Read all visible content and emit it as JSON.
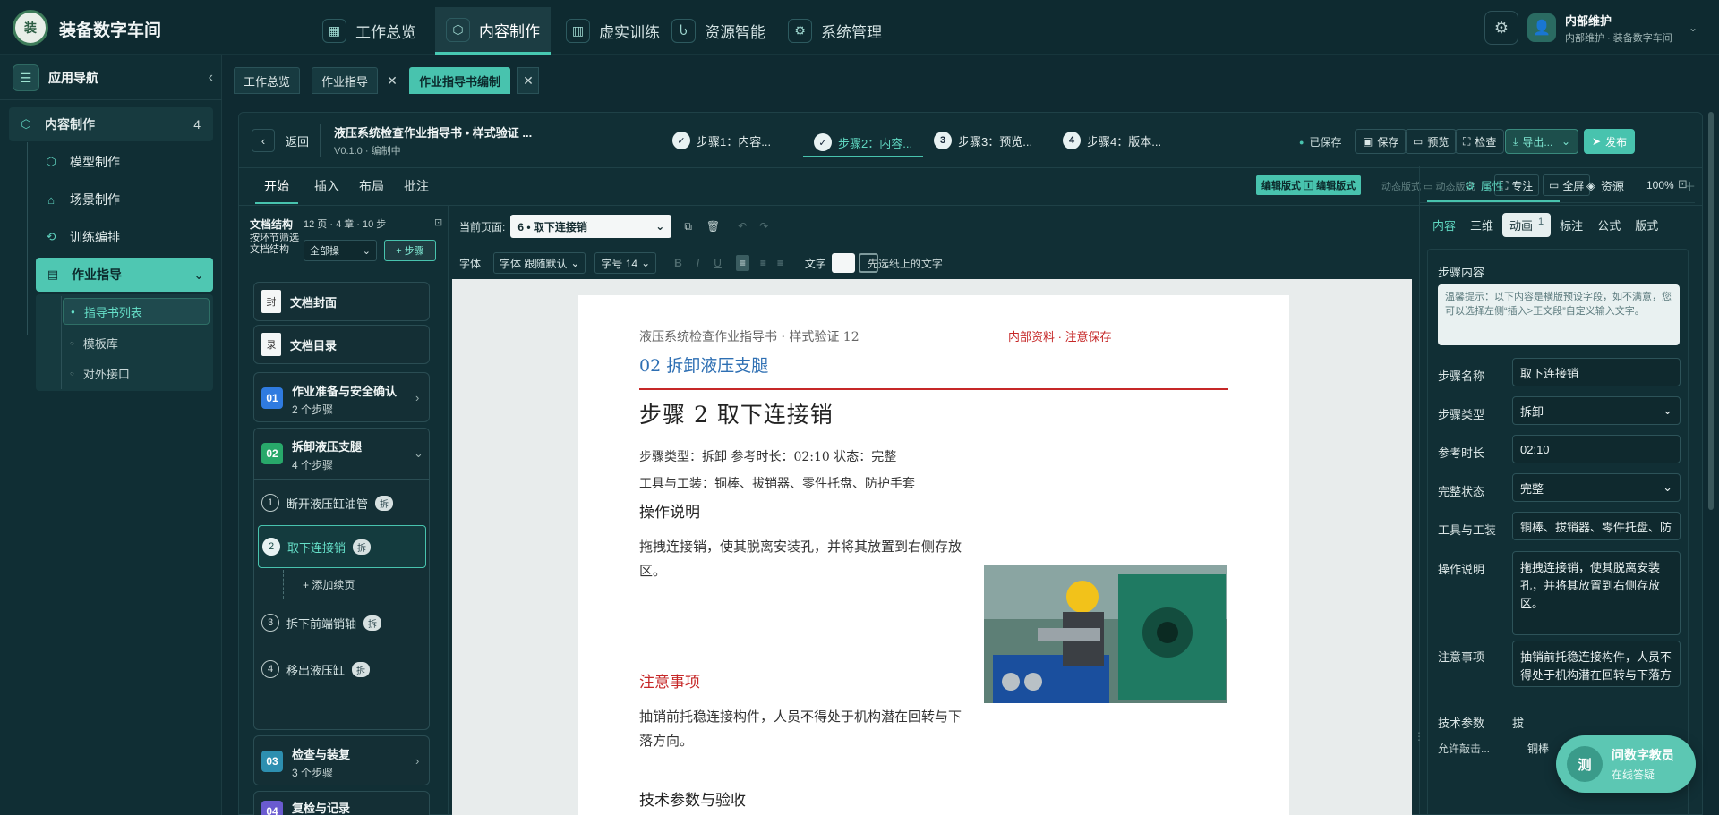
{
  "app": {
    "title": "装备数字车间",
    "logo_text": "装"
  },
  "topnav": [
    {
      "label": "工作总览",
      "icon": "grid-icon",
      "glyph": "▦"
    },
    {
      "label": "内容制作",
      "icon": "cube-icon",
      "glyph": "⬡"
    },
    {
      "label": "虚实训练",
      "icon": "book-icon",
      "glyph": "▥"
    },
    {
      "label": "资源智能",
      "icon": "hook-icon",
      "glyph": "Ⴑ"
    },
    {
      "label": "系统管理",
      "icon": "gear-icon",
      "glyph": "⚙"
    }
  ],
  "user": {
    "name": "内部维护",
    "subtitle": "内部维护 · 装备数字车间"
  },
  "sidebar": {
    "title": "应用导航",
    "section": {
      "label": "内容制作",
      "count": "4"
    },
    "items": [
      {
        "label": "模型制作"
      },
      {
        "label": "场景制作"
      },
      {
        "label": "训练编排"
      },
      {
        "label": "作业指导"
      }
    ],
    "subitems": [
      {
        "label": "指导书列表"
      },
      {
        "label": "模板库"
      },
      {
        "label": "对外接口"
      }
    ]
  },
  "worktabs": [
    {
      "label": "工作总览"
    },
    {
      "label": "作业指导"
    },
    {
      "label": "作业指导书编制"
    }
  ],
  "editor": {
    "back": "返回",
    "doc_title": "液压系统检查作业指导书 • 样式验证 ...",
    "doc_version": "V0.1.0 · 编制中",
    "steps": [
      {
        "num": "✓",
        "label": "步骤1：内容..."
      },
      {
        "num": "✓",
        "label": "步骤2：内容..."
      },
      {
        "num": "3",
        "label": "步骤3：预览..."
      },
      {
        "num": "4",
        "label": "步骤4：版本..."
      }
    ],
    "saved": "已保存",
    "buttons": {
      "save": "保存",
      "preview": "预览",
      "check": "检查",
      "export": "导出...",
      "publish": "发布"
    },
    "ribbon_tabs": [
      "开始",
      "插入",
      "布局",
      "批注"
    ],
    "mode_edit": "编辑版式 🄸 编辑版式",
    "mode_dynamic": "动态版式 ▭ 动态版式",
    "focus": "专注",
    "fullscreen": "全屏",
    "zoom": "100%"
  },
  "structure": {
    "title": "文档结构",
    "summary": "12 页 · 4 章 · 10 步",
    "label2": "按环节筛选文档结构",
    "filter": "全部操",
    "add": "+ 步骤",
    "cover": {
      "badge": "封",
      "label": "文档封面"
    },
    "toc": {
      "badge": "录",
      "label": "文档目录"
    },
    "chapters": [
      {
        "num": "01",
        "title": "作业准备与安全确认",
        "sub": "2 个步骤",
        "color": "#2f7be0"
      },
      {
        "num": "02",
        "title": "拆卸液压支腿",
        "sub": "4 个步骤",
        "color": "#28a86a"
      },
      {
        "num": "03",
        "title": "检查与装复",
        "sub": "3 个步骤",
        "color": "#2d8fb0"
      },
      {
        "num": "04",
        "title": "复检与记录",
        "sub": "",
        "color": "#6a5bd0"
      }
    ],
    "steps": [
      {
        "num": "1",
        "label": "断开液压缸油管",
        "tag": "拆"
      },
      {
        "num": "2",
        "label": "取下连接销",
        "tag": "拆"
      },
      {
        "num": "3",
        "label": "拆下前端销轴",
        "tag": "拆"
      },
      {
        "num": "4",
        "label": "移出液压缸",
        "tag": "拆"
      }
    ],
    "add_page": "+ 添加续页"
  },
  "pagebar": {
    "current_label": "当前页面:",
    "current_value": "6 • 取下连接销"
  },
  "fontbar": {
    "font_label": "字体",
    "font_value": "字体 跟随默认",
    "size_value": "字号 14",
    "text_label": "文字",
    "hint": "先选纸上的文字"
  },
  "page": {
    "header_left": "液压系统检查作业指导书 · 样式验证 12",
    "header_right": "内部资料 · 注意保存",
    "chapter": "02 拆卸液压支腿",
    "step_title": "步骤 2 取下连接销",
    "meta1": "步骤类型：拆卸 参考时长：02:10 状态：完整",
    "meta2": "工具与工装：铜棒、拔销器、零件托盘、防护手套",
    "h_ops": "操作说明",
    "ops": "拖拽连接销，使其脱离安装孔，并将其放置到右侧存放区。",
    "h_notes": "注意事项",
    "notes": "抽销前托稳连接构件，人员不得处于机构潜在回转与下落方向。",
    "h_params": "技术参数与验收"
  },
  "props": {
    "tab_props": "属性",
    "tab_assets": "资源",
    "subtabs": [
      "内容",
      "三维",
      "动画",
      "标注",
      "公式",
      "版式"
    ],
    "anim_count": "1",
    "section": "步骤内容",
    "tip": "温馨提示：以下内容是横版预设字段，如不满意，您可以选择左侧“插入>正文段”自定义输入文字。",
    "fields": [
      {
        "label": "步骤名称",
        "value": "取下连接销"
      },
      {
        "label": "步骤类型",
        "value": "拆卸"
      },
      {
        "label": "参考时长",
        "value": "02:10"
      },
      {
        "label": "完整状态",
        "value": "完整"
      },
      {
        "label": "工具与工装",
        "value": "铜棒、拔销器、零件托盘、防"
      }
    ],
    "ops_label": "操作说明",
    "ops_value": "拖拽连接销，使其脱离安装孔，并将其放置到右侧存放区。",
    "notes_label": "注意事项",
    "notes_value": "抽销前托稳连接构件，人员不得处于机构潜在回转与下落方",
    "params_label": "技术参数",
    "params_value": "拔",
    "row_label": "允许敲击...",
    "row_value": "铜棒"
  },
  "assistant": {
    "badge": "测",
    "title": "问数字教员",
    "sub": "在线答疑"
  },
  "colors": {
    "accent": "#48c3ae",
    "danger": "#c62828",
    "blue_heading": "#2e6fb3"
  }
}
